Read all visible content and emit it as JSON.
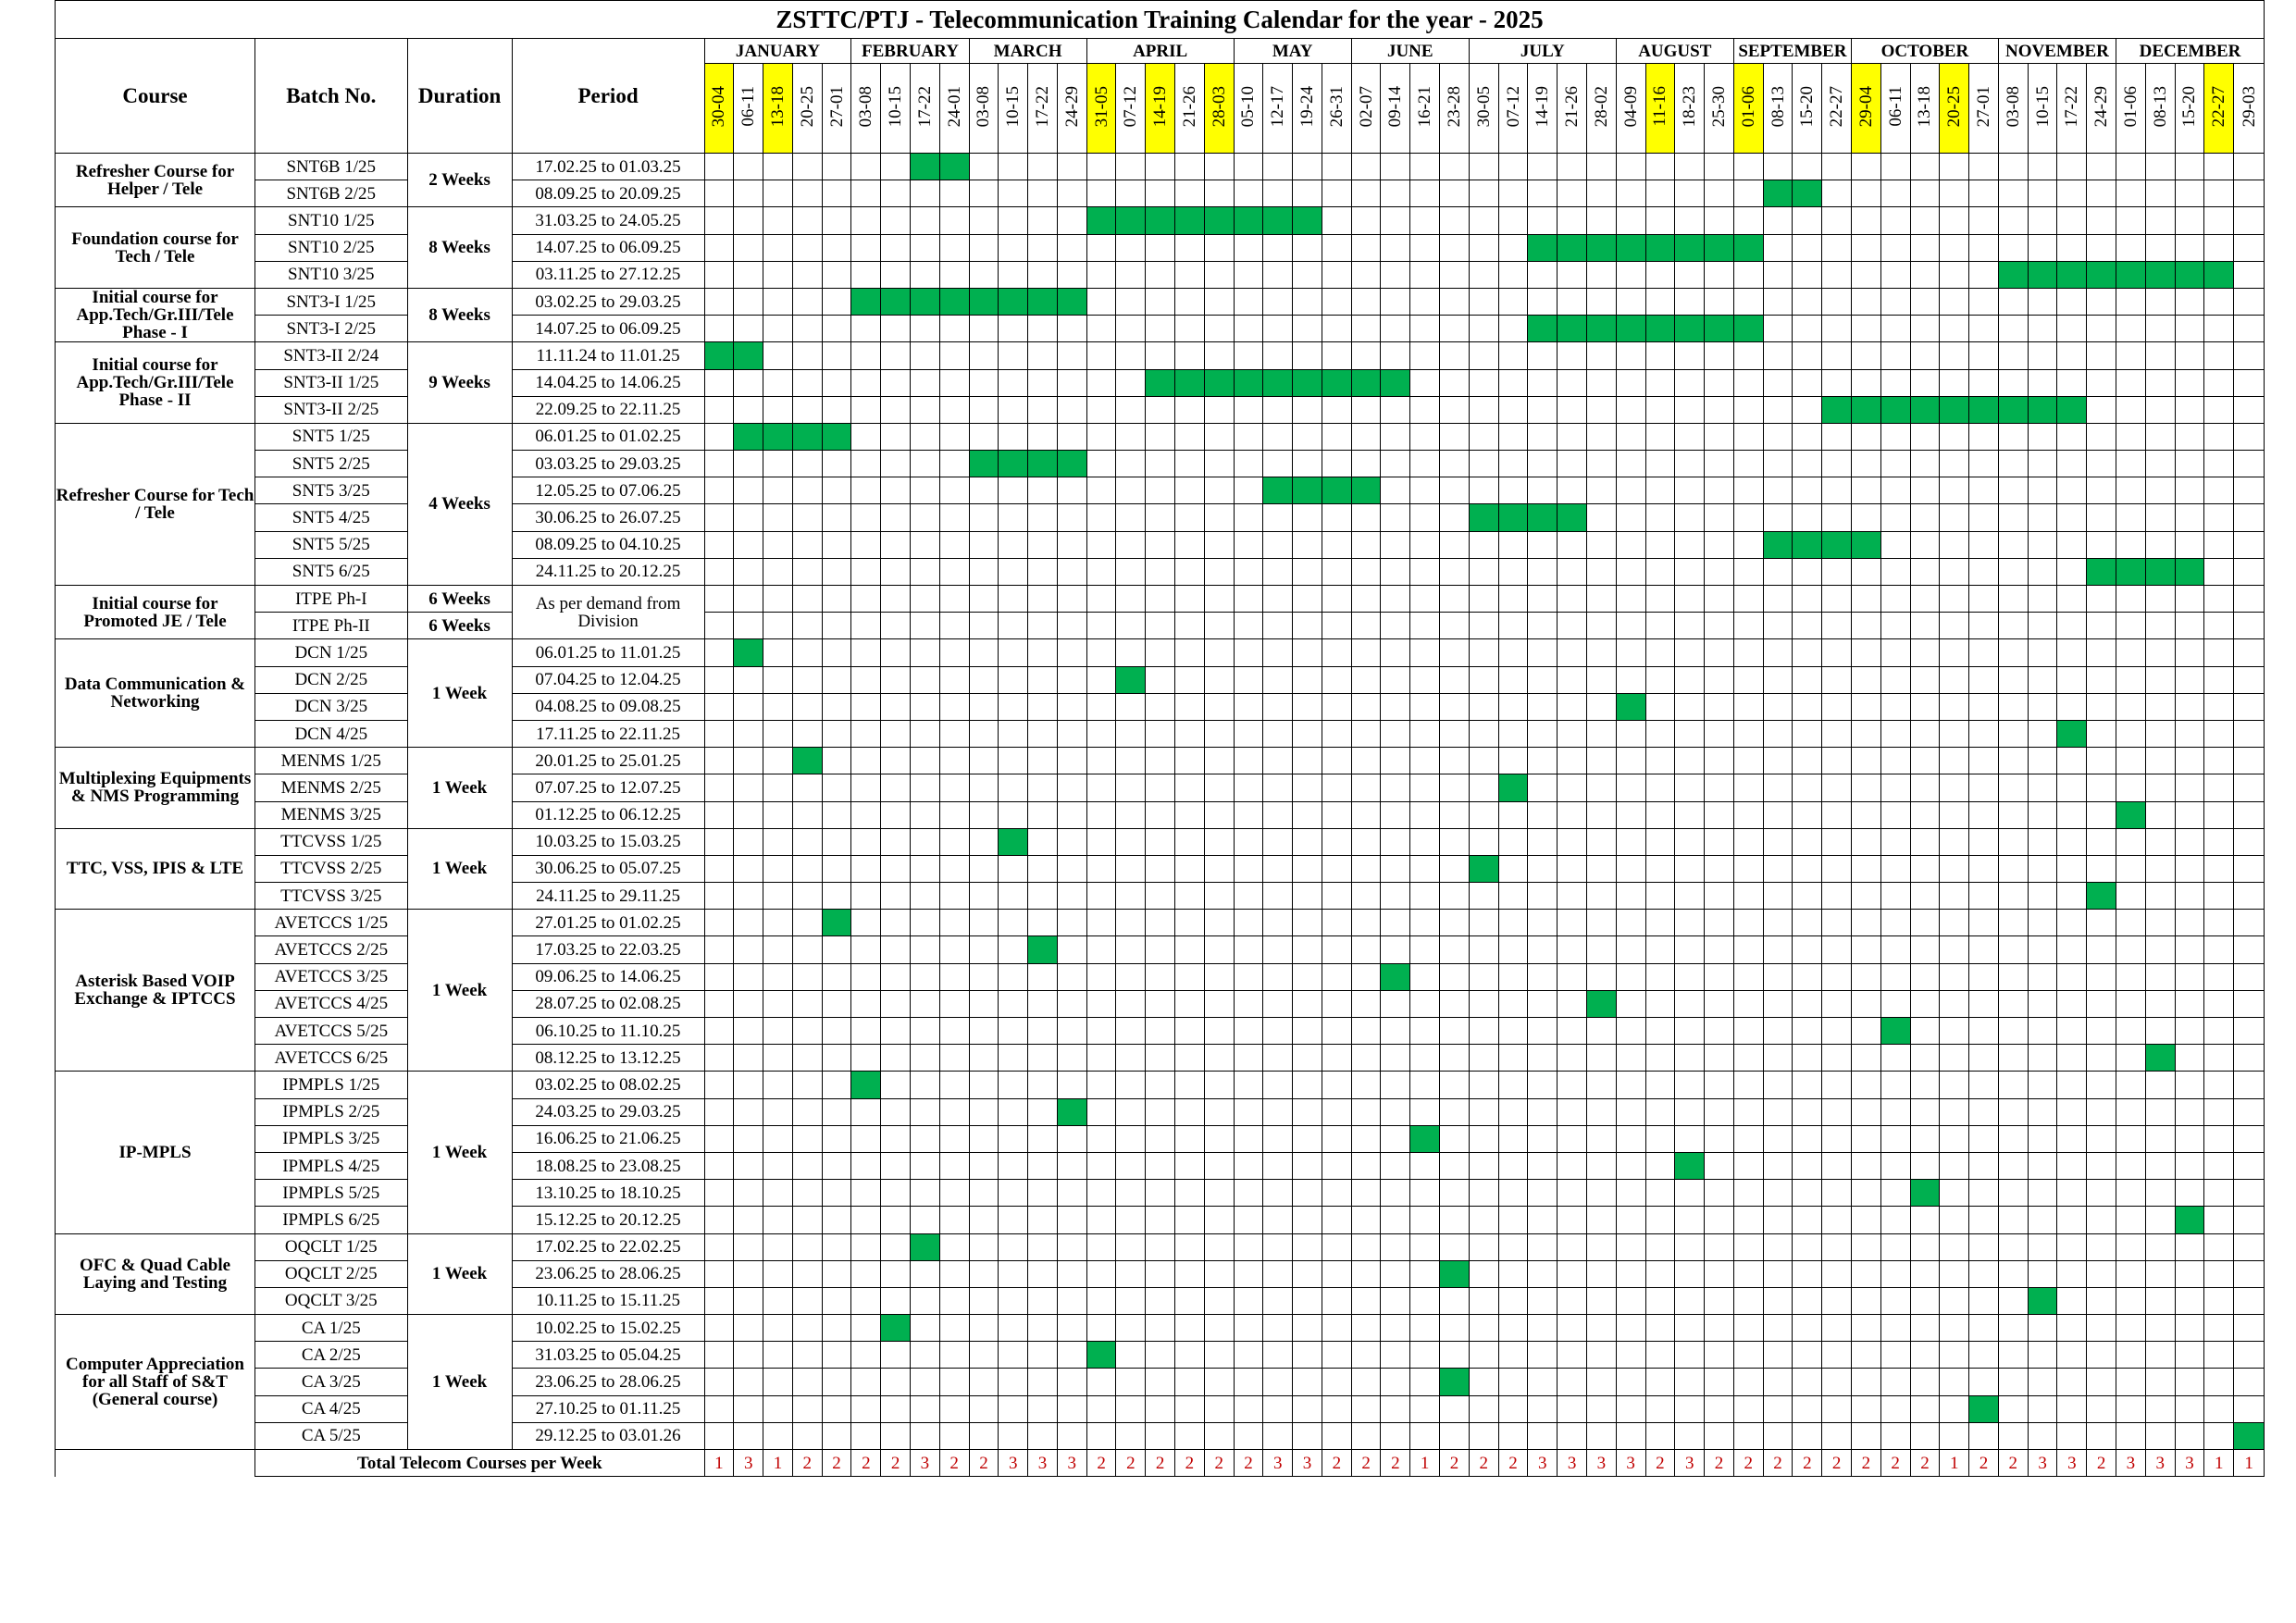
{
  "title": "ZSTTC/PTJ - Telecommunication Training Calendar for the year - 2025",
  "column_headers": {
    "course": "Course",
    "batch": "Batch No.",
    "duration": "Duration",
    "period": "Period"
  },
  "highlight_color": "#ffff00",
  "active_color": "#00b050",
  "total_color": "#c00000",
  "months": [
    {
      "name": "JANUARY",
      "span": 5
    },
    {
      "name": "FEBRUARY",
      "span": 4
    },
    {
      "name": "MARCH",
      "span": 4
    },
    {
      "name": "APRIL",
      "span": 5
    },
    {
      "name": "MAY",
      "span": 4
    },
    {
      "name": "JUNE",
      "span": 4
    },
    {
      "name": "JULY",
      "span": 5
    },
    {
      "name": "AUGUST",
      "span": 4
    },
    {
      "name": "SEPTEMBER",
      "span": 4
    },
    {
      "name": "OCTOBER",
      "span": 5
    },
    {
      "name": "NOVEMBER",
      "span": 4
    },
    {
      "name": "DECEMBER",
      "span": 5
    }
  ],
  "weeks": [
    {
      "label": "30-04",
      "highlight": true
    },
    {
      "label": "06-11",
      "highlight": false
    },
    {
      "label": "13-18",
      "highlight": true
    },
    {
      "label": "20-25",
      "highlight": false
    },
    {
      "label": "27-01",
      "highlight": false
    },
    {
      "label": "03-08",
      "highlight": false
    },
    {
      "label": "10-15",
      "highlight": false
    },
    {
      "label": "17-22",
      "highlight": false
    },
    {
      "label": "24-01",
      "highlight": false
    },
    {
      "label": "03-08",
      "highlight": false
    },
    {
      "label": "10-15",
      "highlight": false
    },
    {
      "label": "17-22",
      "highlight": false
    },
    {
      "label": "24-29",
      "highlight": false
    },
    {
      "label": "31-05",
      "highlight": true
    },
    {
      "label": "07-12",
      "highlight": false
    },
    {
      "label": "14-19",
      "highlight": true
    },
    {
      "label": "21-26",
      "highlight": false
    },
    {
      "label": "28-03",
      "highlight": true
    },
    {
      "label": "05-10",
      "highlight": false
    },
    {
      "label": "12-17",
      "highlight": false
    },
    {
      "label": "19-24",
      "highlight": false
    },
    {
      "label": "26-31",
      "highlight": false
    },
    {
      "label": "02-07",
      "highlight": false
    },
    {
      "label": "09-14",
      "highlight": false
    },
    {
      "label": "16-21",
      "highlight": false
    },
    {
      "label": "23-28",
      "highlight": false
    },
    {
      "label": "30-05",
      "highlight": false
    },
    {
      "label": "07-12",
      "highlight": false
    },
    {
      "label": "14-19",
      "highlight": false
    },
    {
      "label": "21-26",
      "highlight": false
    },
    {
      "label": "28-02",
      "highlight": false
    },
    {
      "label": "04-09",
      "highlight": false
    },
    {
      "label": "11-16",
      "highlight": true
    },
    {
      "label": "18-23",
      "highlight": false
    },
    {
      "label": "25-30",
      "highlight": false
    },
    {
      "label": "01-06",
      "highlight": true
    },
    {
      "label": "08-13",
      "highlight": false
    },
    {
      "label": "15-20",
      "highlight": false
    },
    {
      "label": "22-27",
      "highlight": false
    },
    {
      "label": "29-04",
      "highlight": true
    },
    {
      "label": "06-11",
      "highlight": false
    },
    {
      "label": "13-18",
      "highlight": false
    },
    {
      "label": "20-25",
      "highlight": true
    },
    {
      "label": "27-01",
      "highlight": false
    },
    {
      "label": "03-08",
      "highlight": false
    },
    {
      "label": "10-15",
      "highlight": false
    },
    {
      "label": "17-22",
      "highlight": false
    },
    {
      "label": "24-29",
      "highlight": false
    },
    {
      "label": "01-06",
      "highlight": false
    },
    {
      "label": "08-13",
      "highlight": false
    },
    {
      "label": "15-20",
      "highlight": false
    },
    {
      "label": "22-27",
      "highlight": true
    },
    {
      "label": "29-03",
      "highlight": false
    }
  ],
  "groups": [
    {
      "course": "Refresher Course for Helper / Tele",
      "duration": "2 Weeks",
      "rows": [
        {
          "batch": "SNT6B 1/25",
          "period": "17.02.25 to 01.03.25",
          "active": [
            7,
            8
          ]
        },
        {
          "batch": "SNT6B 2/25",
          "period": "08.09.25 to 20.09.25",
          "active": [
            36,
            37
          ]
        }
      ]
    },
    {
      "course": "Foundation course for Tech / Tele",
      "duration": "8 Weeks",
      "rows": [
        {
          "batch": "SNT10 1/25",
          "period": "31.03.25 to 24.05.25",
          "active": [
            13,
            14,
            15,
            16,
            17,
            18,
            19,
            20
          ]
        },
        {
          "batch": "SNT10 2/25",
          "period": "14.07.25 to 06.09.25",
          "active": [
            28,
            29,
            30,
            31,
            32,
            33,
            34,
            35
          ]
        },
        {
          "batch": "SNT10 3/25",
          "period": "03.11.25 to 27.12.25",
          "active": [
            44,
            45,
            46,
            47,
            48,
            49,
            50,
            51
          ]
        }
      ]
    },
    {
      "course": "Initial course for App.Tech/Gr.III/Tele Phase - I",
      "duration": "8 Weeks",
      "rows": [
        {
          "batch": "SNT3-I 1/25",
          "period": "03.02.25 to 29.03.25",
          "active": [
            5,
            6,
            7,
            8,
            9,
            10,
            11,
            12
          ]
        },
        {
          "batch": "SNT3-I 2/25",
          "period": "14.07.25 to 06.09.25",
          "active": [
            28,
            29,
            30,
            31,
            32,
            33,
            34,
            35
          ]
        }
      ]
    },
    {
      "course": "Initial course for App.Tech/Gr.III/Tele Phase - II",
      "duration": "9 Weeks",
      "rows": [
        {
          "batch": "SNT3-II 2/24",
          "period": "11.11.24 to 11.01.25",
          "active": [
            0,
            1
          ]
        },
        {
          "batch": "SNT3-II 1/25",
          "period": "14.04.25 to 14.06.25",
          "active": [
            15,
            16,
            17,
            18,
            19,
            20,
            21,
            22,
            23
          ]
        },
        {
          "batch": "SNT3-II 2/25",
          "period": "22.09.25 to 22.11.25",
          "active": [
            38,
            39,
            40,
            41,
            42,
            43,
            44,
            45,
            46
          ]
        }
      ]
    },
    {
      "course": "Refresher Course for Tech / Tele",
      "duration": "4 Weeks",
      "rows": [
        {
          "batch": "SNT5 1/25",
          "period": "06.01.25 to 01.02.25",
          "active": [
            1,
            2,
            3,
            4
          ]
        },
        {
          "batch": "SNT5 2/25",
          "period": "03.03.25 to 29.03.25",
          "active": [
            9,
            10,
            11,
            12
          ]
        },
        {
          "batch": "SNT5 3/25",
          "period": "12.05.25 to 07.06.25",
          "active": [
            19,
            20,
            21,
            22
          ]
        },
        {
          "batch": "SNT5 4/25",
          "period": "30.06.25 to 26.07.25",
          "active": [
            26,
            27,
            28,
            29
          ]
        },
        {
          "batch": "SNT5 5/25",
          "period": "08.09.25 to 04.10.25",
          "active": [
            36,
            37,
            38,
            39
          ]
        },
        {
          "batch": "SNT5 6/25",
          "period": "24.11.25 to 20.12.25",
          "active": [
            47,
            48,
            49,
            50
          ]
        }
      ]
    },
    {
      "course": "Initial course for Promoted JE / Tele",
      "duration": null,
      "period_merged": "As per demand from Division",
      "rows": [
        {
          "batch": "ITPE Ph-I",
          "duration": "6 Weeks",
          "active": []
        },
        {
          "batch": "ITPE Ph-II",
          "duration": "6 Weeks",
          "active": []
        }
      ]
    },
    {
      "course": "Data Communication & Networking",
      "duration": "1 Week",
      "rows": [
        {
          "batch": "DCN 1/25",
          "period": "06.01.25 to 11.01.25",
          "active": [
            1
          ]
        },
        {
          "batch": "DCN 2/25",
          "period": "07.04.25 to 12.04.25",
          "active": [
            14
          ]
        },
        {
          "batch": "DCN 3/25",
          "period": "04.08.25 to 09.08.25",
          "active": [
            31
          ]
        },
        {
          "batch": "DCN 4/25",
          "period": "17.11.25 to 22.11.25",
          "active": [
            46
          ]
        }
      ]
    },
    {
      "course": "Multiplexing Equipments & NMS Programming",
      "duration": "1 Week",
      "rows": [
        {
          "batch": "MENMS 1/25",
          "period": "20.01.25 to 25.01.25",
          "active": [
            3
          ]
        },
        {
          "batch": "MENMS 2/25",
          "period": "07.07.25 to 12.07.25",
          "active": [
            27
          ]
        },
        {
          "batch": "MENMS 3/25",
          "period": "01.12.25 to 06.12.25",
          "active": [
            48
          ]
        }
      ]
    },
    {
      "course": "TTC, VSS, IPIS & LTE",
      "duration": "1 Week",
      "rows": [
        {
          "batch": "TTCVSS 1/25",
          "period": "10.03.25 to 15.03.25",
          "active": [
            10
          ]
        },
        {
          "batch": "TTCVSS 2/25",
          "period": "30.06.25 to 05.07.25",
          "active": [
            26
          ]
        },
        {
          "batch": "TTCVSS 3/25",
          "period": "24.11.25 to 29.11.25",
          "active": [
            47
          ]
        }
      ]
    },
    {
      "course": "Asterisk Based VOIP Exchange & IPTCCS",
      "duration": "1 Week",
      "rows": [
        {
          "batch": "AVETCCS 1/25",
          "period": "27.01.25 to 01.02.25",
          "active": [
            4
          ]
        },
        {
          "batch": "AVETCCS 2/25",
          "period": "17.03.25 to 22.03.25",
          "active": [
            11
          ]
        },
        {
          "batch": "AVETCCS 3/25",
          "period": "09.06.25 to 14.06.25",
          "active": [
            23
          ]
        },
        {
          "batch": "AVETCCS 4/25",
          "period": "28.07.25 to 02.08.25",
          "active": [
            30
          ]
        },
        {
          "batch": "AVETCCS 5/25",
          "period": "06.10.25 to 11.10.25",
          "active": [
            40
          ]
        },
        {
          "batch": "AVETCCS 6/25",
          "period": "08.12.25 to 13.12.25",
          "active": [
            49
          ]
        }
      ]
    },
    {
      "course": "IP-MPLS",
      "duration": "1 Week",
      "rows": [
        {
          "batch": "IPMPLS 1/25",
          "period": "03.02.25 to 08.02.25",
          "active": [
            5
          ]
        },
        {
          "batch": "IPMPLS 2/25",
          "period": "24.03.25 to 29.03.25",
          "active": [
            12
          ]
        },
        {
          "batch": "IPMPLS 3/25",
          "period": "16.06.25 to 21.06.25",
          "active": [
            24
          ]
        },
        {
          "batch": "IPMPLS 4/25",
          "period": "18.08.25 to 23.08.25",
          "active": [
            33
          ]
        },
        {
          "batch": "IPMPLS 5/25",
          "period": "13.10.25 to 18.10.25",
          "active": [
            41
          ]
        },
        {
          "batch": "IPMPLS 6/25",
          "period": "15.12.25 to 20.12.25",
          "active": [
            50
          ]
        }
      ]
    },
    {
      "course": "OFC & Quad Cable Laying and Testing",
      "duration": "1 Week",
      "rows": [
        {
          "batch": "OQCLT 1/25",
          "period": "17.02.25 to 22.02.25",
          "active": [
            7
          ]
        },
        {
          "batch": "OQCLT 2/25",
          "period": "23.06.25 to 28.06.25",
          "active": [
            25
          ]
        },
        {
          "batch": "OQCLT 3/25",
          "period": "10.11.25 to 15.11.25",
          "active": [
            45
          ]
        }
      ]
    },
    {
      "course": "Computer Appreciation for all Staff of S&T (General course)",
      "duration": "1 Week",
      "rows": [
        {
          "batch": "CA 1/25",
          "period": "10.02.25 to 15.02.25",
          "active": [
            6
          ]
        },
        {
          "batch": "CA 2/25",
          "period": "31.03.25 to 05.04.25",
          "active": [
            13
          ]
        },
        {
          "batch": "CA 3/25",
          "period": "23.06.25 to 28.06.25",
          "active": [
            25
          ]
        },
        {
          "batch": "CA 4/25",
          "period": "27.10.25 to 01.11.25",
          "active": [
            43
          ]
        },
        {
          "batch": "CA 5/25",
          "period": "29.12.25 to 03.01.26",
          "active": [
            52
          ]
        }
      ]
    }
  ],
  "totals_label": "Total Telecom Courses per Week",
  "totals": [
    1,
    3,
    1,
    2,
    2,
    2,
    2,
    3,
    2,
    2,
    3,
    3,
    3,
    2,
    2,
    2,
    2,
    2,
    2,
    3,
    3,
    2,
    2,
    2,
    1,
    2,
    2,
    2,
    3,
    3,
    3,
    3,
    2,
    3,
    2,
    2,
    2,
    2,
    2,
    2,
    2,
    2,
    1,
    2,
    2,
    3,
    3,
    2,
    3,
    3,
    3,
    1,
    1
  ]
}
